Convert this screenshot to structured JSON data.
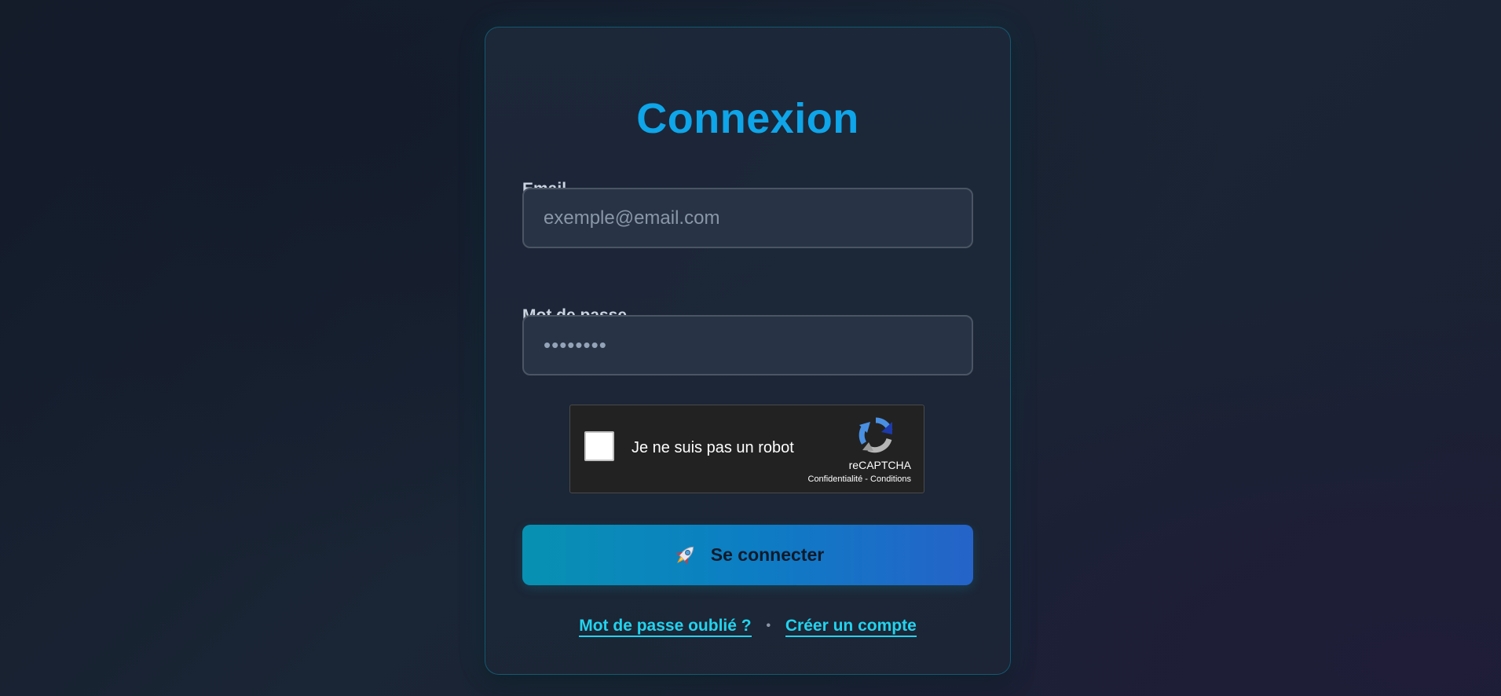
{
  "login": {
    "title": "Connexion",
    "email_label": "Email",
    "email_placeholder": "exemple@email.com",
    "password_label": "Mot de passe",
    "password_value": "••••••••",
    "submit_label": "Se connecter",
    "submit_icon": "rocket-icon"
  },
  "recaptcha": {
    "checkbox_label": "Je ne suis pas un robot",
    "checked": false,
    "brand": "reCAPTCHA",
    "privacy_link": "Confidentialité",
    "separator": "-",
    "terms_link": "Conditions"
  },
  "footer_links": {
    "forgot_password": "Mot de passe oublié ?",
    "separator": "•",
    "create_account": "Créer un compte"
  },
  "colors": {
    "accent": "#0ea5e9",
    "link": "#22d3ee",
    "button_gradient_start": "#0891b2",
    "button_gradient_end": "#2563c9"
  }
}
